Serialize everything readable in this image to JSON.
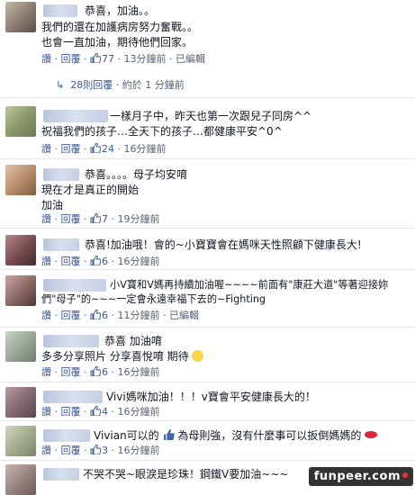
{
  "c1": {
    "line1": "恭喜，加油。。",
    "line2": "我們的還在加護病房努力奮戰。。",
    "line3": "也會一直加油，期待他們回家。",
    "reply": "讚",
    "respond": "回覆",
    "likes": "77",
    "time": "13分鐘前",
    "edited": "已編輯"
  },
  "replies": {
    "count": "28則回覆",
    "who": "約於 1 分鐘前"
  },
  "c2": {
    "line1": "一樣月子中，昨天也第一次跟兒子同房^^",
    "line2": "祝福我們的孩子…全天下的孩子…都健康平安^0^",
    "reply": "讚",
    "respond": "回覆",
    "likes": "24",
    "time": "16分鐘前"
  },
  "c3": {
    "line1": "恭喜。。。。母子均安唷",
    "line2": "現在才是真正的開始",
    "line3": "加油",
    "reply": "讚",
    "respond": "回覆",
    "likes": "7",
    "time": "19分鐘前"
  },
  "c4": {
    "line1": "恭喜!加油哦！會的~小寶寶會在媽咪天性照顧下健康長大!",
    "reply": "讚",
    "respond": "回覆",
    "likes": "6",
    "time": "16分鐘前"
  },
  "c5": {
    "line1": "小V寶和V媽再持續加油喔~~~~前面有\"康莊大道\"等著迎接妳",
    "line2": "們\"母子\"的~~~一定會永遠幸福下去的~Fighting",
    "reply": "讚",
    "respond": "回覆",
    "likes": "6",
    "time": "11分鐘前",
    "edited": "已編輯"
  },
  "c6": {
    "line1": "恭喜 加油唷",
    "line2": "多多分享照片 分享喜悅唷 期待",
    "reply": "讚",
    "respond": "回覆",
    "likes": "6",
    "time": "16分鐘前"
  },
  "c7": {
    "line1": "Vivi媽咪加油！！！v寶會平安健康長大的！",
    "reply": "讚",
    "respond": "回覆",
    "likes": "4",
    "time": "16分鐘前"
  },
  "c8": {
    "line1": "Vivian可以的",
    "line2": "為母則強，沒有什麼事可以扳倒媽媽的",
    "reply": "讚",
    "respond": "回覆",
    "likes": "3",
    "time": "16分鐘前"
  },
  "c9": {
    "line1": "不哭不哭~眼淚是珍珠！鋼鐵V要加油~~~"
  },
  "watermark": "funpeer.com",
  "colors": {
    "link": "#3b5998",
    "meta": "#5a6272"
  }
}
